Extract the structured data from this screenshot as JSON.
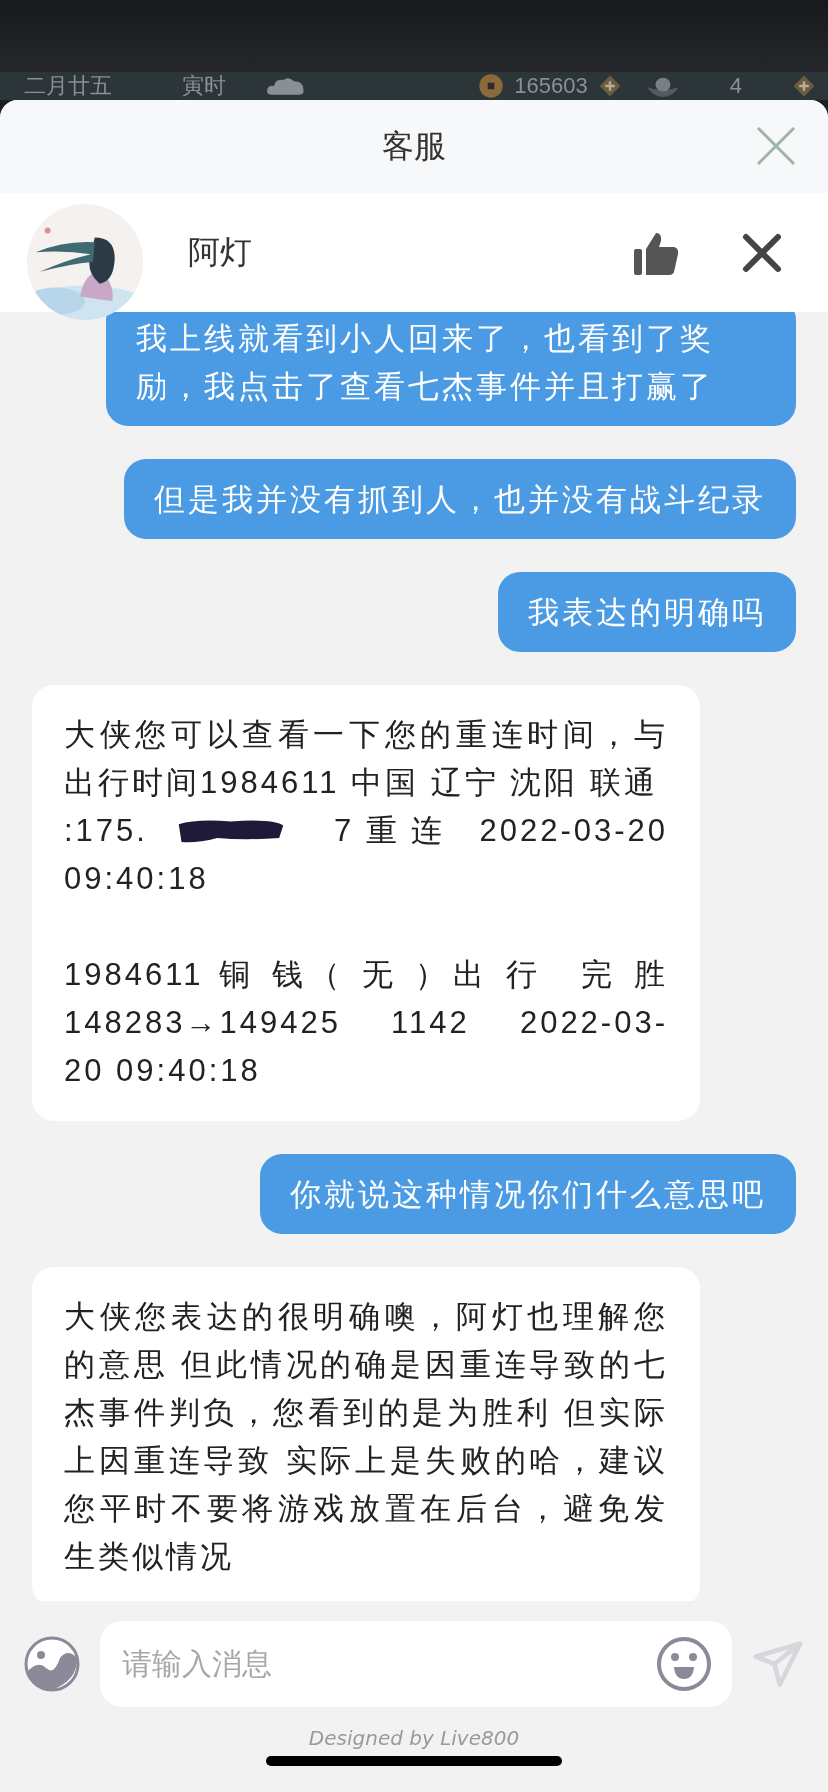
{
  "game_bar": {
    "date": "二月廿五",
    "hour": "寅时",
    "coins": "165603",
    "ingots": "4"
  },
  "sheet": {
    "title": "客服"
  },
  "agent": {
    "name": "阿灯"
  },
  "messages": [
    {
      "kind": "user",
      "paragraphs": [
        {
          "kind": "block",
          "parts": [
            {
              "kind": "text",
              "text": "我上线就看到小人回来了，也看到了奖励，我点击了查看七杰事件并且打赢了"
            }
          ]
        }
      ]
    },
    {
      "kind": "user",
      "paragraphs": [
        {
          "kind": "block",
          "parts": [
            {
              "kind": "text",
              "text": "但是我并没有抓到人，也并没有战斗纪录"
            }
          ]
        }
      ]
    },
    {
      "kind": "user",
      "paragraphs": [
        {
          "kind": "block",
          "parts": [
            {
              "kind": "text",
              "text": "我表达的明确吗"
            }
          ]
        }
      ]
    },
    {
      "kind": "agent",
      "paragraphs": [
        {
          "kind": "block",
          "parts": [
            {
              "kind": "text",
              "text": "大侠您可以查看一下您的重连时间，与出行时间1984611 中国 辽宁 沈阳 联通"
            }
          ]
        },
        {
          "kind": "row",
          "parts": [
            {
              "kind": "text",
              "text": ":175."
            },
            {
              "kind": "redaction"
            },
            {
              "kind": "text",
              "text": "7 重 连　2022-03-20"
            }
          ]
        },
        {
          "kind": "block",
          "parts": [
            {
              "kind": "text",
              "text": "09:40:18"
            }
          ]
        },
        {
          "kind": "block",
          "spaced": true,
          "parts": [
            {
              "kind": "text",
              "text": "1984611 铜 钱（ 无 ）出 行　完 胜 148283→149425　1142　2022-03-20 09:40:18"
            }
          ]
        }
      ]
    },
    {
      "kind": "user",
      "paragraphs": [
        {
          "kind": "block",
          "parts": [
            {
              "kind": "text",
              "text": "你就说这种情况你们什么意思吧"
            }
          ]
        }
      ]
    },
    {
      "kind": "agent",
      "paragraphs": [
        {
          "kind": "block",
          "parts": [
            {
              "kind": "text",
              "text": "大侠您表达的很明确噢，阿灯也理解您的意思 但此情况的确是因重连导致的七杰事件判负，您看到的是为胜利 但实际上因重连导致 实际上是失败的哈，建议您平时不要将游戏放置在后台，避免发生类似情况"
            }
          ]
        }
      ]
    }
  ],
  "input": {
    "placeholder": "请输入消息"
  },
  "footer": "Designed by Live800"
}
